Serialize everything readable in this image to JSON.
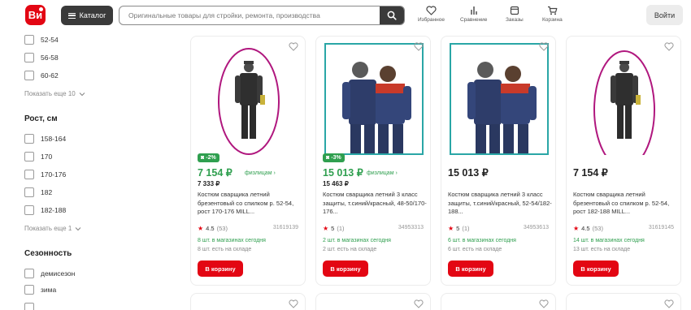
{
  "header": {
    "logo_text": "Ви",
    "catalog_label": "Каталог",
    "search_placeholder": "Оригинальные товары для стройки, ремонта, производства",
    "nav": [
      {
        "label": "Избранное",
        "icon": "heart-icon"
      },
      {
        "label": "Сравнение",
        "icon": "compare-icon"
      },
      {
        "label": "Заказы",
        "icon": "orders-icon"
      },
      {
        "label": "Корзина",
        "icon": "cart-icon"
      }
    ],
    "login_label": "Войти"
  },
  "sidebar": {
    "size_options": [
      "52-54",
      "56-58",
      "60-62"
    ],
    "size_show_more": "Показать еще 10",
    "height_title": "Рост, см",
    "height_options": [
      "158-164",
      "170",
      "170-176",
      "182",
      "182-188"
    ],
    "height_show_more": "Показать еще 1",
    "season_title": "Сезонность",
    "season_options": [
      "демисезон",
      "зима"
    ]
  },
  "products": [
    {
      "badge": "-2%",
      "price": "7 154 ₽",
      "price_note": "физлицам ›",
      "old_price": "7 333 ₽",
      "title": "Костюм сварщика летний брезентовый со спилком р. 52-54, рост 170-176 MILL...",
      "rating": "4.5",
      "reviews": "(53)",
      "sku": "31619139",
      "stock_store": "8 шт. в магазинах сегодня",
      "stock_warehouse": "8 шт. есть на складе",
      "cart_label": "В корзину"
    },
    {
      "badge": "-3%",
      "price": "15 013 ₽",
      "price_note": "физлицам ›",
      "old_price": "15 463 ₽",
      "title": "Костюм сварщика летний 3 класс защиты, т.синий/красный, 48-50/170-176...",
      "rating": "5",
      "reviews": "(1)",
      "sku": "34953313",
      "stock_store": "2 шт. в магазинах сегодня",
      "stock_warehouse": "2 шт. есть на складе",
      "cart_label": "В корзину"
    },
    {
      "badge": "",
      "price": "15 013 ₽",
      "price_note": "",
      "old_price": "",
      "title": "Костюм сварщика летний 3 класс защиты, т.синий/красный, 52-54/182-188...",
      "rating": "5",
      "reviews": "(1)",
      "sku": "34953613",
      "stock_store": "6 шт. в магазинах сегодня",
      "stock_warehouse": "6 шт. есть на складе",
      "cart_label": "В корзину"
    },
    {
      "badge": "",
      "price": "7 154 ₽",
      "price_note": "",
      "old_price": "",
      "title": "Костюм сварщика летний брезентовый со спилком р. 52-54, рост 182-188 MILL...",
      "rating": "4.5",
      "reviews": "(53)",
      "sku": "31619145",
      "stock_store": "14 шт. в магазинах сегодня",
      "stock_warehouse": "13 шт. есть на складе",
      "cart_label": "В корзину"
    }
  ],
  "colors": {
    "brand_red": "#e30613",
    "discount_green": "#2f9f4f",
    "annotation_magenta": "#b0177e",
    "annotation_teal": "#2aa6a6"
  }
}
